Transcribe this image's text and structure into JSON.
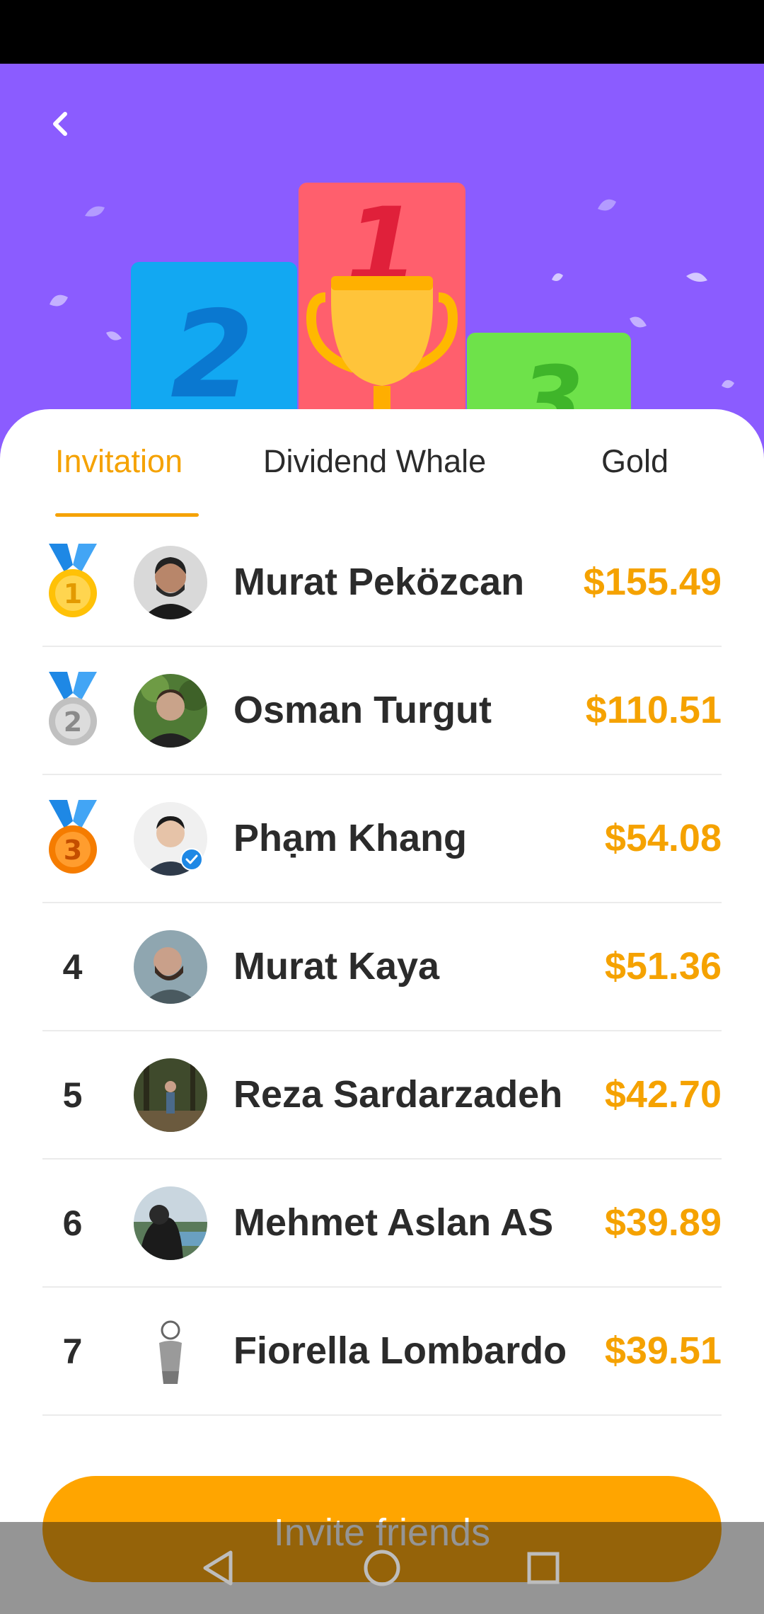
{
  "tabs": [
    {
      "label": "Invitation",
      "active": true
    },
    {
      "label": "Dividend Whale",
      "active": false
    },
    {
      "label": "Gold",
      "active": false
    }
  ],
  "leaderboard": [
    {
      "rank": "1",
      "medal": "gold-medal-icon",
      "name": "Murat Peközcan",
      "amount": "$155.49"
    },
    {
      "rank": "2",
      "medal": "silver-medal-icon",
      "name": "Osman Turgut",
      "amount": "$110.51"
    },
    {
      "rank": "3",
      "medal": "bronze-medal-icon",
      "name": "Phạm Khang",
      "amount": "$54.08",
      "verified": true
    },
    {
      "rank": "4",
      "name": "Murat Kaya",
      "amount": "$51.36"
    },
    {
      "rank": "5",
      "name": "Reza Sardarzadeh",
      "amount": "$42.70"
    },
    {
      "rank": "6",
      "name": "Mehmet Aslan AS",
      "amount": "$39.89"
    },
    {
      "rank": "7",
      "name": "Fiorella Lombardo",
      "amount": "$39.51"
    }
  ],
  "invite": {
    "label": "Invite friends"
  },
  "colors": {
    "accent": "#f5a200",
    "header": "#8b5cff",
    "button": "#ffa500",
    "text": "#2b2b2b"
  }
}
